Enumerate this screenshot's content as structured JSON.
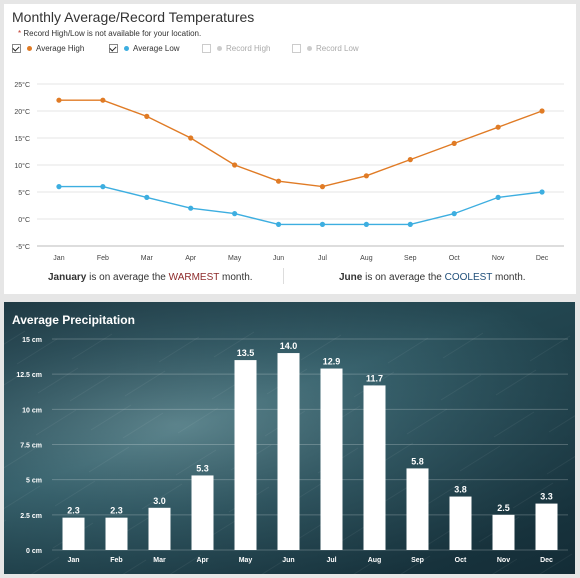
{
  "temperature": {
    "title": "Monthly Average/Record Temperatures",
    "note_star": "*",
    "note": "Record High/Low is not available for your location.",
    "legend": [
      {
        "label": "Average High",
        "checked": true,
        "color": "#e07b25"
      },
      {
        "label": "Average Low",
        "checked": true,
        "color": "#3daee0"
      },
      {
        "label": "Record High",
        "checked": false,
        "color": "#cccccc"
      },
      {
        "label": "Record Low",
        "checked": false,
        "color": "#cccccc"
      }
    ],
    "warm_month": "January",
    "warm_prefix": "is on average the",
    "warm_word": "WARMEST",
    "warm_suffix": "month.",
    "cool_month": "June",
    "cool_prefix": "is on average the",
    "cool_word": "COOLEST",
    "cool_suffix": "month."
  },
  "precipitation": {
    "title": "Average Precipitation"
  },
  "chart_data": [
    {
      "type": "line",
      "title": "Monthly Average/Record Temperatures",
      "categories": [
        "Jan",
        "Feb",
        "Mar",
        "Apr",
        "May",
        "Jun",
        "Jul",
        "Aug",
        "Sep",
        "Oct",
        "Nov",
        "Dec"
      ],
      "series": [
        {
          "name": "Average High",
          "values": [
            22,
            22,
            19,
            15,
            10,
            7,
            6,
            8,
            11,
            14,
            17,
            20
          ],
          "color": "#e07b25"
        },
        {
          "name": "Average Low",
          "values": [
            6,
            6,
            4,
            2,
            1,
            -1,
            -1,
            -1,
            -1,
            1,
            4,
            5
          ],
          "color": "#3daee0"
        }
      ],
      "yticks": [
        "25°C",
        "20°C",
        "15°C",
        "10°C",
        "5°C",
        "0°C",
        "-5°C"
      ],
      "ylim": [
        -5,
        25
      ],
      "grid": true,
      "legend_position": "top-left"
    },
    {
      "type": "bar",
      "title": "Average Precipitation",
      "categories": [
        "Jan",
        "Feb",
        "Mar",
        "Apr",
        "May",
        "Jun",
        "Jul",
        "Aug",
        "Sep",
        "Oct",
        "Nov",
        "Dec"
      ],
      "values": [
        2.3,
        2.3,
        3.0,
        5.3,
        13.5,
        14.0,
        12.9,
        11.7,
        5.8,
        3.8,
        2.5,
        3.3
      ],
      "value_labels": [
        "2.3",
        "2.3",
        "3.0",
        "5.3",
        "13.5",
        "14.0",
        "12.9",
        "11.7",
        "5.8",
        "3.8",
        "2.5",
        "3.3"
      ],
      "yticks": [
        "15 cm",
        "12.5 cm",
        "10 cm",
        "7.5 cm",
        "5 cm",
        "2.5 cm",
        "0 cm"
      ],
      "ylim": [
        0,
        15
      ],
      "bar_color": "#ffffff",
      "grid": true
    }
  ]
}
